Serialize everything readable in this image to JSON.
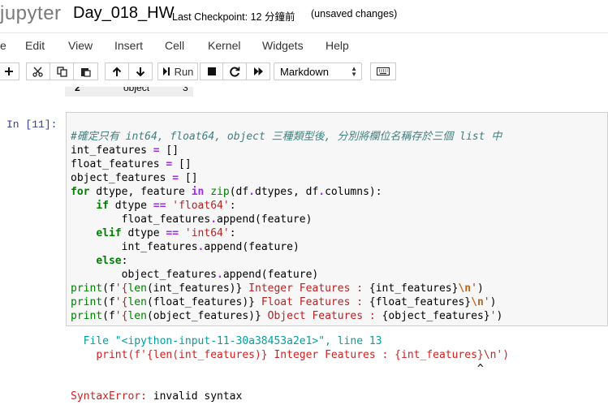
{
  "header": {
    "logo": "jupyter",
    "notebook_name": "Day_018_HW",
    "checkpoint": "Last Checkpoint: 12 分鐘前",
    "unsaved": "(unsaved changes)"
  },
  "menu": [
    "e",
    "Edit",
    "View",
    "Insert",
    "Cell",
    "Kernel",
    "Widgets",
    "Help"
  ],
  "toolbar": {
    "run_label": "Run",
    "cell_type": "Markdown",
    "icons": [
      "plus-icon",
      "cut-icon",
      "copy-icon",
      "paste-icon",
      "arrow-up-icon",
      "arrow-down-icon",
      "run-icon",
      "stop-icon",
      "restart-icon",
      "fast-forward-icon",
      "keyboard-icon"
    ]
  },
  "previous_output_row": {
    "index": "2",
    "dtype": "object",
    "count": "3"
  },
  "cell": {
    "prompt": "In [11]:",
    "comment": "#確定只有 int64, float64, object 三種類型後, 分別將欄位名稱存於三個 list 中",
    "vars": [
      "int_features",
      "float_features",
      "object_features"
    ],
    "float_str": "'float64'",
    "int_str": "'int64'"
  },
  "error": {
    "file_line_prefix": "File ",
    "file_name": "\"<ipython-input-11-30a38453a2e1>\"",
    "line_info": ", line 13",
    "caret": "^",
    "error_type": "SyntaxError:",
    "error_message": " invalid syntax"
  }
}
